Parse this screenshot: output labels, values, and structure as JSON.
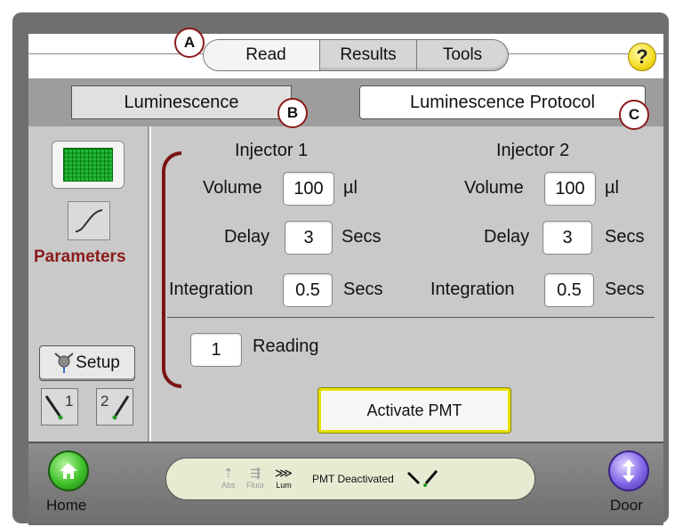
{
  "tabs": [
    {
      "label": "Read",
      "active": true
    },
    {
      "label": "Results",
      "active": false
    },
    {
      "label": "Tools",
      "active": false
    }
  ],
  "help_label": "?",
  "mode": {
    "label": "Luminescence"
  },
  "protocol": {
    "label": "Luminescence Protocol"
  },
  "sidebar": {
    "parameters_label": "Parameters",
    "setup_label": "Setup",
    "injector_buttons": [
      {
        "num": "1"
      },
      {
        "num": "2"
      }
    ]
  },
  "injector1": {
    "title": "Injector 1",
    "volume_label": "Volume",
    "volume_value": "100",
    "volume_unit": "µl",
    "delay_label": "Delay",
    "delay_value": "3",
    "delay_unit": "Secs",
    "integration_label": "Integration",
    "integration_value": "0.5",
    "integration_unit": "Secs"
  },
  "injector2": {
    "title": "Injector 2",
    "volume_label": "Volume",
    "volume_value": "100",
    "volume_unit": "µl",
    "delay_label": "Delay",
    "delay_value": "3",
    "delay_unit": "Secs",
    "integration_label": "Integration",
    "integration_value": "0.5",
    "integration_unit": "Secs"
  },
  "reading": {
    "value": "1",
    "label": "Reading"
  },
  "activate_pmt_label": "Activate PMT",
  "footer": {
    "home_label": "Home",
    "door_label": "Door",
    "modes": [
      {
        "label": "Abs",
        "icon": "abs-icon"
      },
      {
        "label": "Fluor",
        "icon": "fluor-icon"
      },
      {
        "label": "Lum",
        "icon": "lum-icon"
      }
    ],
    "status_text": "PMT Deactivated"
  },
  "callouts": {
    "a": "A",
    "b": "B",
    "c": "C"
  },
  "colors": {
    "accent_red": "#8b1a1a",
    "pmt_border": "#e8e000",
    "home": "#3ec22a",
    "door": "#8467e8"
  }
}
